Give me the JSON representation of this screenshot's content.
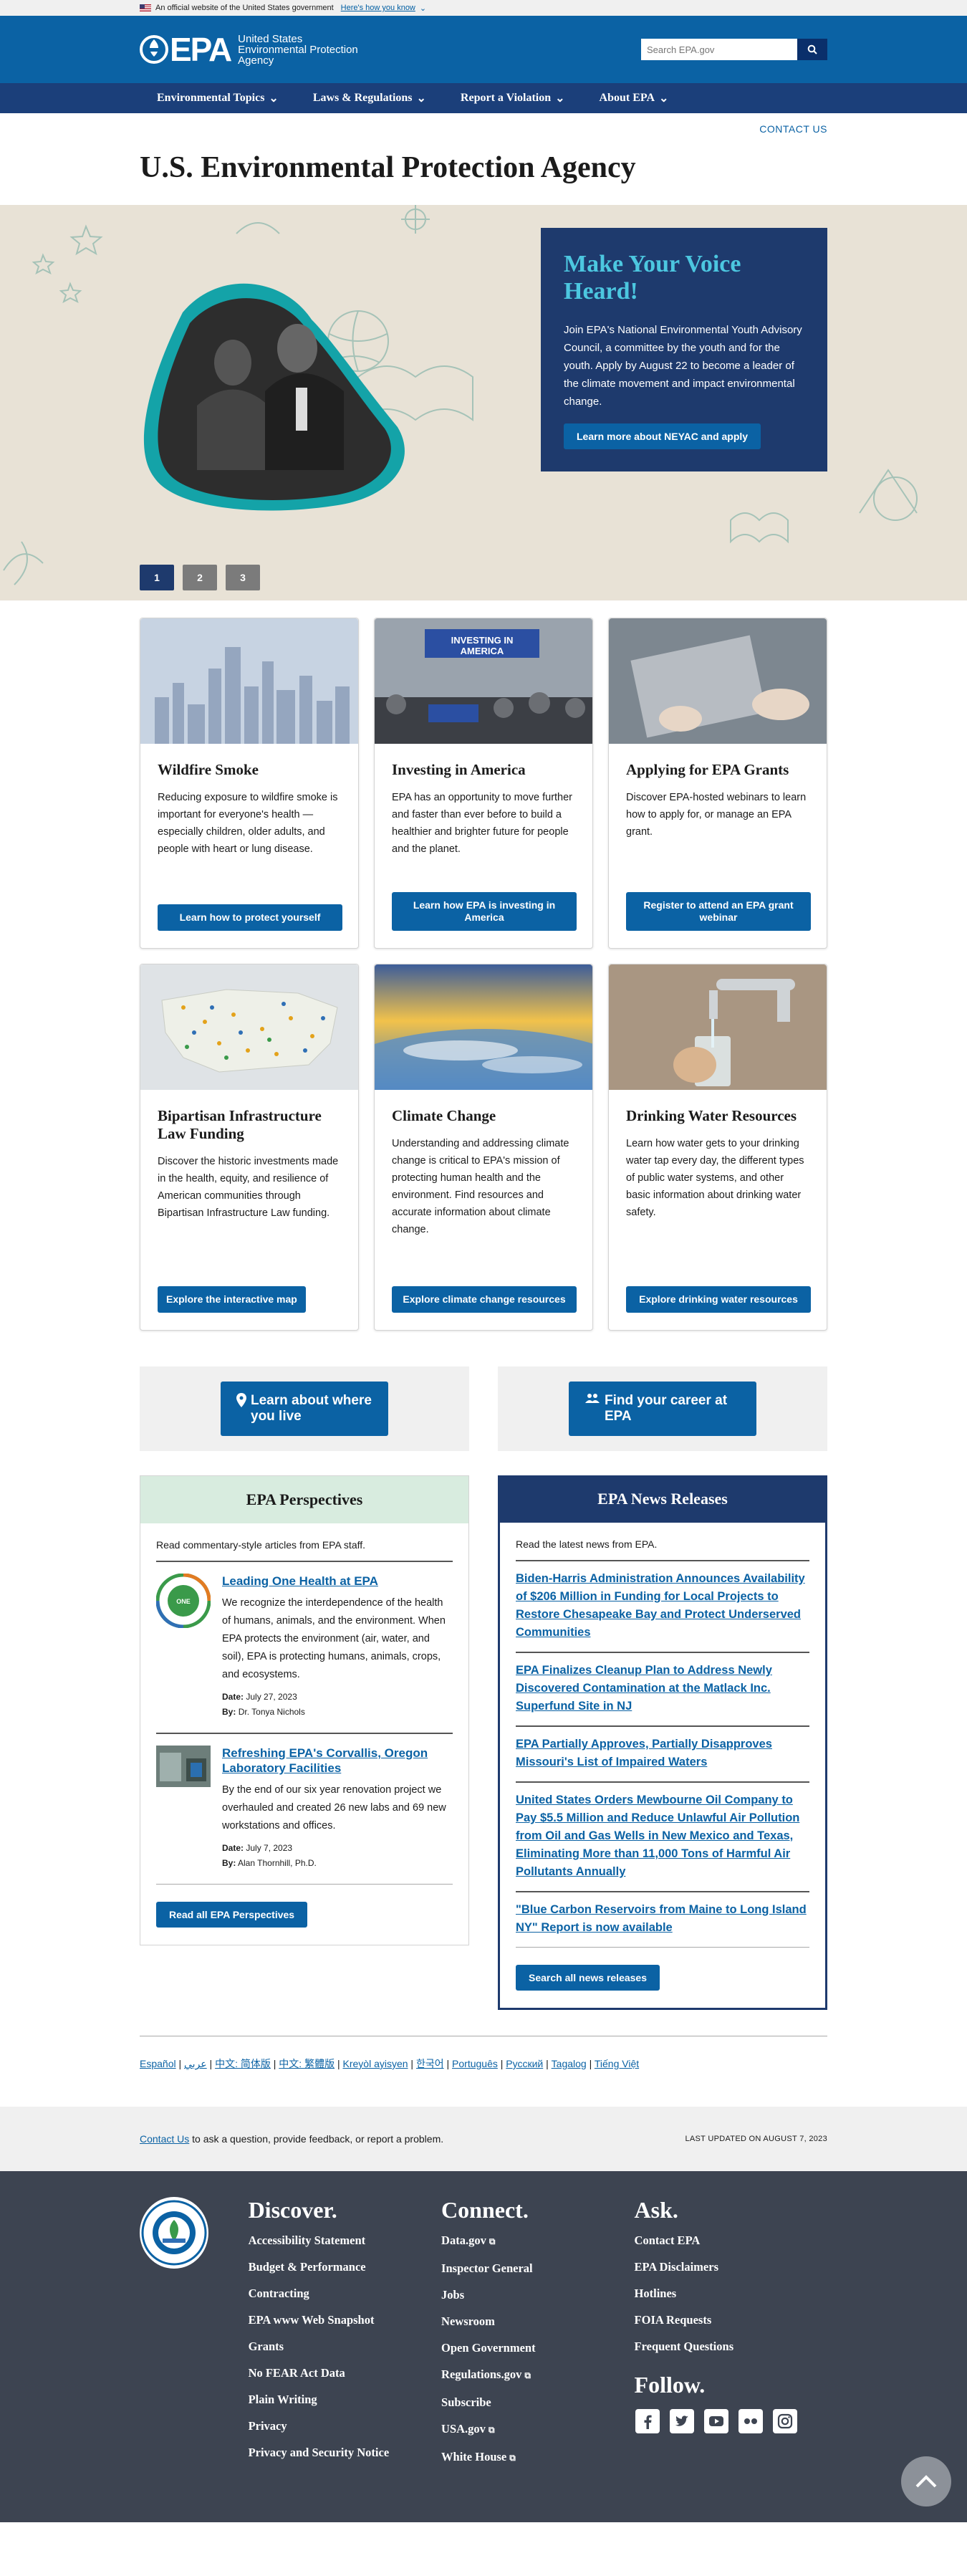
{
  "gov_banner": {
    "text": "An official website of the United States government",
    "link": "Here's how you know"
  },
  "header": {
    "logo": "EPA",
    "logo_text": [
      "United States",
      "Environmental Protection",
      "Agency"
    ],
    "search_placeholder": "Search EPA.gov"
  },
  "nav": [
    "Environmental Topics",
    "Laws & Regulations",
    "Report a Violation",
    "About EPA"
  ],
  "contact_top": "CONTACT US",
  "page_title": "U.S. Environmental Protection Agency",
  "hero": {
    "title": "Make Your Voice Heard!",
    "text": "Join EPA's National Environmental Youth Advisory Council, a committee by the youth and for the youth. Apply by August 22 to become a leader of the climate movement and impact environmental change.",
    "button": "Learn more about NEYAC and apply",
    "dots": [
      "1",
      "2",
      "3"
    ]
  },
  "cards": [
    {
      "title": "Wildfire Smoke",
      "text": "Reducing exposure to wildfire smoke is important for everyone's health — especially children, older adults, and people with heart or lung disease.",
      "button": "Learn how to protect yourself"
    },
    {
      "title": "Investing in America",
      "text": "EPA has an opportunity to move further and faster than ever before to build a healthier and brighter future for people and the planet.",
      "button": "Learn how EPA is investing in America"
    },
    {
      "title": "Applying for EPA Grants",
      "text": "Discover EPA-hosted webinars to learn how to apply for, or manage an EPA grant.",
      "button": "Register to attend an EPA grant webinar"
    },
    {
      "title": "Bipartisan Infrastructure Law Funding",
      "text": "Discover the historic investments made in the health, equity, and resilience of American communities through Bipartisan Infrastructure Law funding.",
      "button": "Explore the interactive map"
    },
    {
      "title": "Climate Change",
      "text": "Understanding and addressing climate change is critical to EPA's mission of protecting human health and the environment. Find resources and accurate information about climate change.",
      "button": "Explore climate change resources"
    },
    {
      "title": "Drinking Water Resources",
      "text": "Learn how water gets to your drinking water tap every day, the different types of public water systems, and other basic information about drinking water safety.",
      "button": "Explore drinking water resources"
    }
  ],
  "big_buttons": [
    "Learn about where you live",
    "Find your career at EPA"
  ],
  "perspectives": {
    "title": "EPA Perspectives",
    "intro": "Read commentary-style articles from EPA staff.",
    "items": [
      {
        "title": "Leading One Health at EPA",
        "text": "We recognize the interdependence of the health of humans, animals, and the environment. When EPA protects the environment (air, water, and soil), EPA is protecting humans, animals, crops, and ecosystems.",
        "date_label": "Date:",
        "date": "July 27, 2023",
        "by_label": "By:",
        "by": "Dr. Tonya Nichols"
      },
      {
        "title": "Refreshing EPA's Corvallis, Oregon Laboratory Facilities",
        "text": "By the end of our six year renovation project we overhauled and created 26 new labs and 69 new workstations and offices.",
        "date_label": "Date:",
        "date": "July 7, 2023",
        "by_label": "By:",
        "by": "Alan Thornhill, Ph.D."
      }
    ],
    "button": "Read all EPA Perspectives"
  },
  "news": {
    "title": "EPA News Releases",
    "intro": "Read the latest news from EPA.",
    "items": [
      "Biden-Harris Administration Announces Availability of $206 Million in Funding for Local Projects to Restore Chesapeake Bay and Protect Underserved Communities",
      "EPA Finalizes Cleanup Plan to Address Newly Discovered Contamination at the Matlack Inc. Superfund Site in NJ",
      "EPA Partially Approves, Partially Disapproves Missouri's List of Impaired Waters",
      "United States Orders Mewbourne Oil Company to Pay $5.5 Million and Reduce Unlawful Air Pollution from Oil and Gas Wells in New Mexico and Texas, Eliminating More than 11,000 Tons of Harmful Air Pollutants Annually",
      "\"Blue Carbon Reservoirs from Maine to Long Island NY\" Report is now available"
    ],
    "button": "Search all news releases"
  },
  "languages": [
    "Español",
    "عربي",
    "中文: 简体版",
    "中文: 繁體版",
    "Kreyòl ayisyen",
    "한국어",
    "Português",
    "Русский",
    "Tagalog",
    "Tiếng Việt"
  ],
  "contact_bar": {
    "link": "Contact Us",
    "text": " to ask a question, provide feedback, or report a problem.",
    "updated": "LAST UPDATED ON AUGUST 7, 2023"
  },
  "footer": {
    "discover": {
      "title": "Discover.",
      "links": [
        "Accessibility Statement",
        "Budget & Performance",
        "Contracting",
        "EPA www Web Snapshot",
        "Grants",
        "No FEAR Act Data",
        "Plain Writing",
        "Privacy",
        "Privacy and Security Notice"
      ]
    },
    "connect": {
      "title": "Connect.",
      "links": [
        "Data.gov",
        "Inspector General",
        "Jobs",
        "Newsroom",
        "Open Government",
        "Regulations.gov",
        "Subscribe",
        "USA.gov",
        "White House"
      ]
    },
    "ask": {
      "title": "Ask.",
      "links": [
        "Contact EPA",
        "EPA Disclaimers",
        "Hotlines",
        "FOIA Requests",
        "Frequent Questions"
      ]
    },
    "follow": "Follow."
  },
  "colors": {
    "header_blue": "#0b62a4",
    "nav_navy": "#1b3f7a",
    "hero_card": "#1e3a6d",
    "hero_title": "#4cc7e0",
    "footer_bg": "#3d4451"
  }
}
